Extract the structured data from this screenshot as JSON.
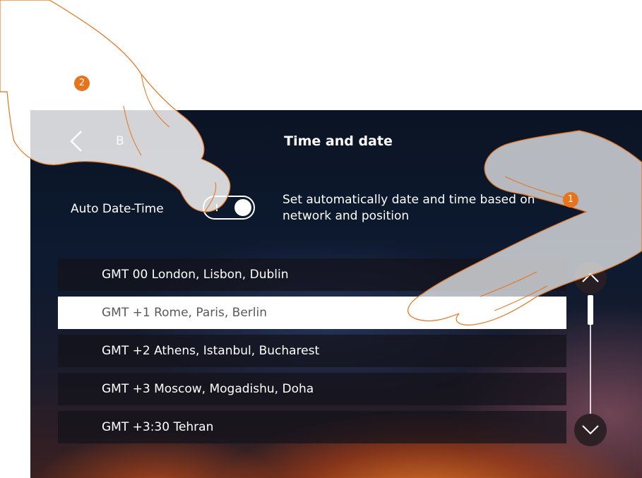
{
  "header": {
    "back_label": "B",
    "title": "Time and date"
  },
  "auto_date_time": {
    "label": "Auto Date-Time",
    "enabled": true,
    "description": "Set automatically date and time based on network and position"
  },
  "timezones": [
    {
      "label": "GMT 00 London, Lisbon, Dublin",
      "selected": false
    },
    {
      "label": "GMT +1 Rome, Paris, Berlin",
      "selected": true
    },
    {
      "label": "GMT +2 Athens, Istanbul, Bucharest",
      "selected": false
    },
    {
      "label": "GMT +3 Moscow, Mogadishu, Doha",
      "selected": false
    },
    {
      "label": "GMT +3:30 Tehran",
      "selected": false
    }
  ],
  "icons": {
    "back": "chevron-left-icon",
    "scroll_up": "chevron-up-icon",
    "scroll_down": "chevron-down-icon",
    "hand": "pointing-hand-icon"
  },
  "steps": [
    "1",
    "2"
  ],
  "colors": {
    "accent": "#e8731a",
    "selected_row": "#ffffff",
    "selected_text": "#5a5a5a"
  }
}
